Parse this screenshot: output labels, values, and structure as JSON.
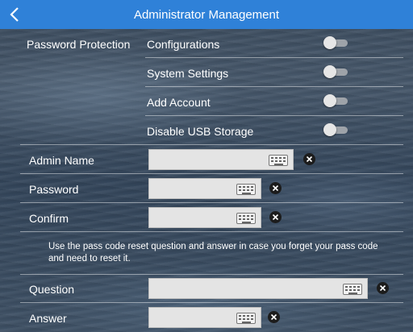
{
  "header": {
    "title": "Administrator Management",
    "back_icon": "chevron-left-icon",
    "color": "#2f81d8"
  },
  "password_protection": {
    "label": "Password Protection",
    "toggles": [
      {
        "label": "Configurations",
        "on": false
      },
      {
        "label": "System Settings",
        "on": false
      },
      {
        "label": "Add Account",
        "on": false
      },
      {
        "label": "Disable USB Storage",
        "on": false
      }
    ]
  },
  "fields": {
    "admin_name": {
      "label": "Admin Name",
      "value": "",
      "keyboard_icon": "keyboard-icon",
      "clear_icon": "clear-icon"
    },
    "password": {
      "label": "Password",
      "value": "",
      "keyboard_icon": "keyboard-icon",
      "clear_icon": "clear-icon"
    },
    "confirm": {
      "label": "Confirm",
      "value": "",
      "keyboard_icon": "keyboard-icon",
      "clear_icon": "clear-icon"
    },
    "question": {
      "label": "Question",
      "value": "",
      "keyboard_icon": "keyboard-icon",
      "clear_icon": "clear-icon"
    },
    "answer": {
      "label": "Answer",
      "value": "",
      "keyboard_icon": "keyboard-icon",
      "clear_icon": "clear-icon"
    }
  },
  "info_text": "Use the pass code reset question and answer in case you forget your pass code and need to reset it."
}
